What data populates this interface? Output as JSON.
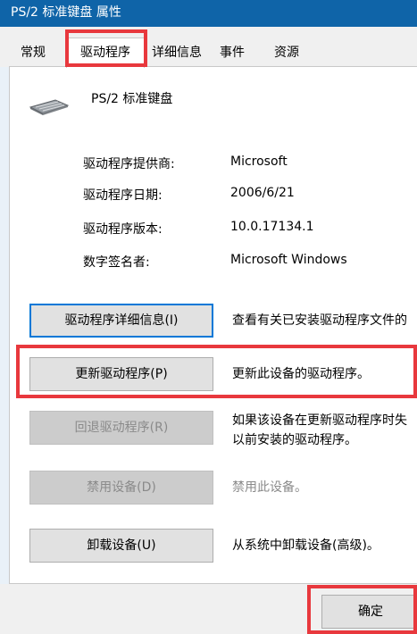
{
  "window": {
    "title": "PS/2 标准键盘 属性"
  },
  "tabs": [
    {
      "label": "常规"
    },
    {
      "label": "驱动程序"
    },
    {
      "label": "详细信息"
    },
    {
      "label": "事件"
    },
    {
      "label": "资源"
    }
  ],
  "active_tab": "驱动程序",
  "device": {
    "name": "PS/2 标准键盘",
    "icon": "keyboard-icon"
  },
  "driver_info": [
    {
      "label": "驱动程序提供商:",
      "value": "Microsoft"
    },
    {
      "label": "驱动程序日期:",
      "value": "2006/6/21"
    },
    {
      "label": "驱动程序版本:",
      "value": "10.0.17134.1"
    },
    {
      "label": "数字签名者:",
      "value": "Microsoft Windows"
    }
  ],
  "actions": [
    {
      "button": "驱动程序详细信息(I)",
      "description": [
        "查看有关已安装驱动程序文件的"
      ],
      "enabled": true
    },
    {
      "button": "更新驱动程序(P)",
      "description": [
        "更新此设备的驱动程序。"
      ],
      "enabled": true
    },
    {
      "button": "回退驱动程序(R)",
      "description": [
        "如果该设备在更新驱动程序时失",
        "以前安装的驱动程序。"
      ],
      "enabled": false
    },
    {
      "button": "禁用设备(D)",
      "description": [
        "禁用此设备。"
      ],
      "enabled": false
    },
    {
      "button": "卸载设备(U)",
      "description": [
        "从系统中卸载设备(高级)。"
      ],
      "enabled": true
    }
  ],
  "footer": {
    "ok_label": "确定"
  },
  "colors": {
    "titlebar": "#0f64a8",
    "highlight": "#e8383d",
    "focus": "#0078d7"
  }
}
